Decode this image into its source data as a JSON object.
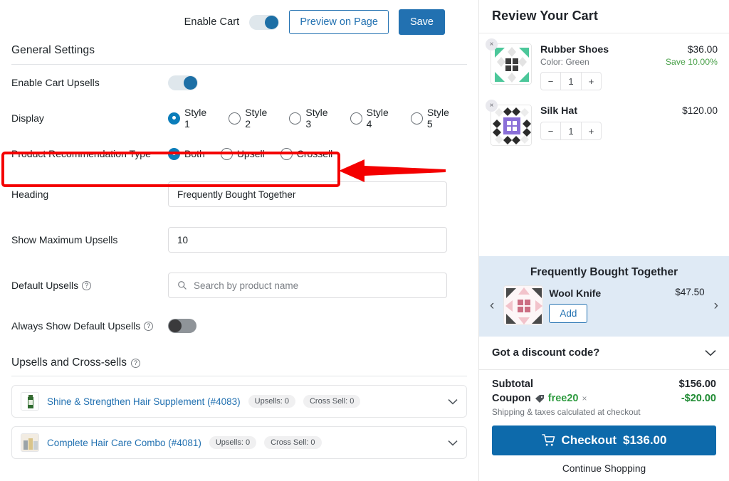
{
  "topbar": {
    "enable_cart_label": "Enable Cart",
    "enable_cart_on": true,
    "preview_label": "Preview on Page",
    "save_label": "Save"
  },
  "settings": {
    "section_title": "General Settings",
    "enable_upsells": {
      "label": "Enable Cart Upsells",
      "on": true
    },
    "display": {
      "label": "Display",
      "options": [
        "Style 1",
        "Style 2",
        "Style 3",
        "Style 4",
        "Style 5"
      ],
      "selected": "Style 1"
    },
    "recommendation_type": {
      "label": "Product Recommendation Type",
      "options": [
        "Both",
        "Upsell",
        "Crossell"
      ],
      "selected": "Both"
    },
    "heading": {
      "label": "Heading",
      "value": "Frequently Bought Together"
    },
    "max_upsells": {
      "label": "Show Maximum Upsells",
      "value": "10"
    },
    "default_upsells": {
      "label": "Default Upsells",
      "placeholder": "Search by product name",
      "icon": "search-icon"
    },
    "always_show": {
      "label": "Always Show Default Upsells",
      "on": false
    },
    "upsells_cross_sells_title": "Upsells and Cross-sells",
    "products": [
      {
        "name": "Shine & Strengthen Hair Supplement (#4083)",
        "upsells_chip": "Upsells: 0",
        "crosssell_chip": "Cross Sell: 0"
      },
      {
        "name": "Complete Hair Care Combo (#4081)",
        "upsells_chip": "Upsells: 0",
        "crosssell_chip": "Cross Sell: 0"
      }
    ]
  },
  "annotation": {
    "box_color": "#f40000",
    "arrow_color": "#f40000",
    "highlights": "product-recommendation-type-row"
  },
  "cart": {
    "title": "Review Your Cart",
    "items": [
      {
        "name": "Rubber Shoes",
        "variant": "Color: Green",
        "price": "$36.00",
        "save": "Save 10.00%",
        "qty": "1",
        "minus": "−",
        "plus": "+",
        "remove": "×"
      },
      {
        "name": "Silk Hat",
        "variant": "",
        "price": "$120.00",
        "save": "",
        "qty": "1",
        "minus": "−",
        "plus": "+",
        "remove": "×"
      }
    ],
    "fbt": {
      "title": "Frequently Bought Together",
      "prev": "‹",
      "next": "›",
      "product": {
        "name": "Wool Knife",
        "price": "$47.50",
        "add_label": "Add"
      }
    },
    "discount": {
      "label": "Got a discount code?"
    },
    "totals": {
      "subtotal_label": "Subtotal",
      "subtotal_value": "$156.00",
      "coupon_label": "Coupon",
      "coupon_code": "free20",
      "coupon_remove": "×",
      "coupon_value": "-$20.00",
      "shipping_note": "Shipping & taxes calculated at checkout"
    },
    "checkout": {
      "label": "Checkout",
      "amount": "$136.00",
      "icon": "cart-icon"
    },
    "continue_label": "Continue Shopping"
  }
}
